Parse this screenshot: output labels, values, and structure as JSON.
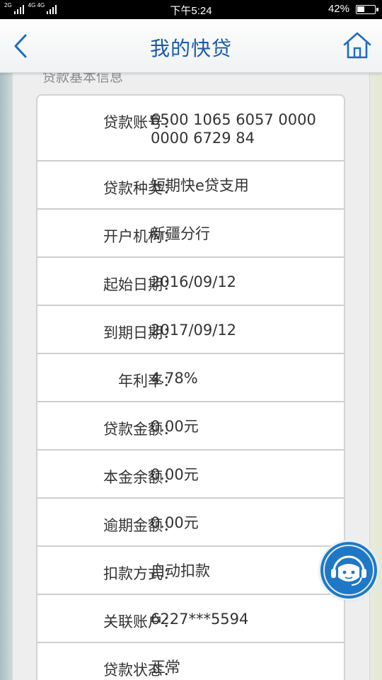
{
  "status_bar": {
    "sim1": "2G",
    "sim2": "4G 4G",
    "time": "下午5:24",
    "battery_percent": "42%",
    "battery_level": 0.42
  },
  "header": {
    "title": "我的快贷",
    "back_icon": "chevron-left-icon",
    "home_icon": "home-icon"
  },
  "section": {
    "title": "贷款基本信息"
  },
  "loan_info": [
    {
      "label": "贷款账号：",
      "value": "6500 1065 6057 0000 0000 6729 84"
    },
    {
      "label": "贷款种类：",
      "value": "短期快e贷支用"
    },
    {
      "label": "开户机构：",
      "value": "新疆分行"
    },
    {
      "label": "起始日期：",
      "value": "2016/09/12"
    },
    {
      "label": "到期日期：",
      "value": "2017/09/12"
    },
    {
      "label": "年利率：",
      "value": "4.78%"
    },
    {
      "label": "贷款金额：",
      "value": "0.00元"
    },
    {
      "label": "本金余额：",
      "value": "0.00元"
    },
    {
      "label": "逾期金额：",
      "value": "0.00元"
    },
    {
      "label": "扣款方式：",
      "value": "自动扣款"
    },
    {
      "label": "关联账户：",
      "value": "6227***5594"
    },
    {
      "label": "贷款状态：",
      "value": "正常"
    }
  ],
  "support_icon": "customer-service-icon",
  "colors": {
    "accent": "#1b5aa8",
    "support_bg": "#1f78c6"
  }
}
